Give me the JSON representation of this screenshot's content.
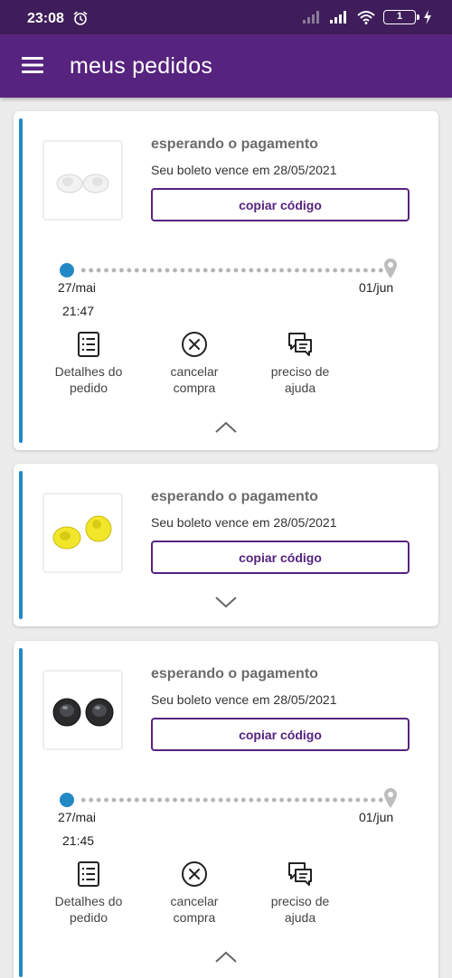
{
  "status_bar": {
    "time": "23:08",
    "battery": "1"
  },
  "app_bar": {
    "title": "meus pedidos"
  },
  "orders": [
    {
      "status": "esperando o pagamento",
      "due_text": "Seu boleto vence em 28/05/2021",
      "copy_label": "copiar código",
      "product": "white-earbuds",
      "expanded": true,
      "timeline": {
        "start_date": "27/mai",
        "start_time": "21:47",
        "end_date": "01/jun"
      },
      "actions": [
        {
          "icon": "order-details-icon",
          "label_line1": "Detalhes do",
          "label_line2": "pedido"
        },
        {
          "icon": "cancel-icon",
          "label_line1": "cancelar",
          "label_line2": "compra"
        },
        {
          "icon": "help-chat-icon",
          "label_line1": "preciso de",
          "label_line2": "ajuda"
        }
      ]
    },
    {
      "status": "esperando o pagamento",
      "due_text": "Seu boleto vence em 28/05/2021",
      "copy_label": "copiar código",
      "product": "yellow-earbuds",
      "expanded": false
    },
    {
      "status": "esperando o pagamento",
      "due_text": "Seu boleto vence em 28/05/2021",
      "copy_label": "copiar código",
      "product": "black-earbuds",
      "expanded": true,
      "timeline": {
        "start_date": "27/mai",
        "start_time": "21:45",
        "end_date": "01/jun"
      },
      "actions": [
        {
          "icon": "order-details-icon",
          "label_line1": "Detalhes do",
          "label_line2": "pedido"
        },
        {
          "icon": "cancel-icon",
          "label_line1": "cancelar",
          "label_line2": "compra"
        },
        {
          "icon": "help-chat-icon",
          "label_line1": "preciso de",
          "label_line2": "ajuda"
        }
      ]
    }
  ],
  "colors": {
    "app_bar": "#56237f",
    "status_bar": "#3f1d5a",
    "accent": "#2389c4",
    "button_border": "#56237f"
  }
}
